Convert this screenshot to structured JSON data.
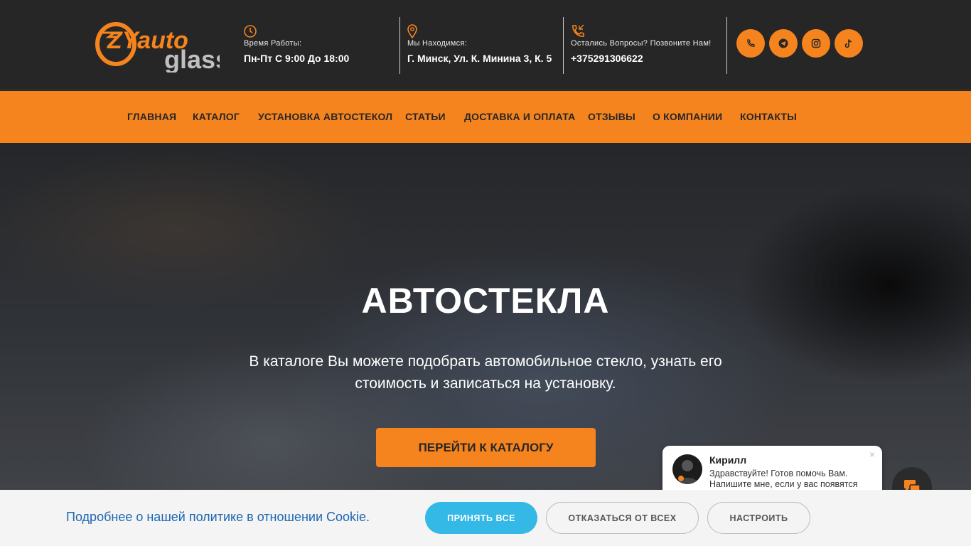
{
  "header": {
    "logo": {
      "line1": "ZYauto",
      "line2": "glass"
    },
    "hours": {
      "label": "Время Работы:",
      "value": "Пн-Пт С 9:00 До 18:00",
      "icon": "clock-icon"
    },
    "location": {
      "label": "Мы Находимся:",
      "value": "Г. Минск, Ул. К. Минина 3, К. 5",
      "icon": "map-pin-icon"
    },
    "phone": {
      "label": "Остались Вопросы? Позвоните Нам!",
      "value": "+375291306622",
      "icon": "phone-icon"
    },
    "socials": [
      "viber-icon",
      "telegram-icon",
      "instagram-icon",
      "tiktok-icon"
    ]
  },
  "nav": {
    "items": [
      "ГЛАВНАЯ",
      "КАТАЛОГ",
      "УСТАНОВКА АВТОСТЕКОЛ",
      "СТАТЬИ",
      "ДОСТАВКА И ОПЛАТА",
      "ОТЗЫВЫ",
      "О КОМПАНИИ",
      "КОНТАКТЫ"
    ]
  },
  "hero": {
    "title": "АВТОСТЕКЛА",
    "text": "В каталоге Вы можете подобрать автомобильное стекло, узнать его стоимость и записаться на установку.",
    "button": "ПЕРЕЙТИ К КАТАЛОГУ"
  },
  "chat": {
    "name": "Кирилл",
    "message": "Здравствуйте! Готов помочь Вам. Напишите мне, если у вас появятся",
    "close": "×"
  },
  "cookie": {
    "text": "Подробнее о нашей политике в отношении Cookie.",
    "accept": "ПРИНЯТЬ ВСЕ",
    "reject": "ОТКАЗАТЬСЯ ОТ ВСЕХ",
    "customize": "НАСТРОИТЬ"
  },
  "colors": {
    "accent": "#f5841f",
    "dark": "#262626",
    "cookie_accept": "#34b8e6",
    "cookie_link": "#1b67b2"
  }
}
